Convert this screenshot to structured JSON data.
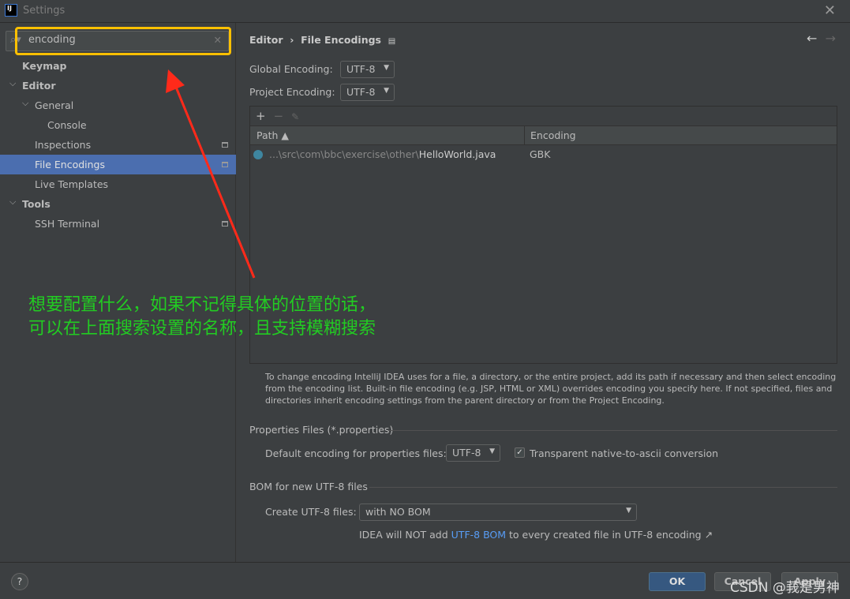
{
  "window": {
    "title": "Settings",
    "logo": "IJ"
  },
  "search": {
    "value": "encoding"
  },
  "sidebar": {
    "items": [
      {
        "label": "Keymap",
        "bold": true,
        "level": 0,
        "chev": false
      },
      {
        "label": "Editor",
        "bold": true,
        "level": 0,
        "chev": true
      },
      {
        "label": "General",
        "level": 1,
        "chev": true
      },
      {
        "label": "Console",
        "level": 2
      },
      {
        "label": "Inspections",
        "level": 1,
        "mod": true
      },
      {
        "label": "File Encodings",
        "level": 1,
        "mod": true,
        "selected": true
      },
      {
        "label": "Live Templates",
        "level": 1
      },
      {
        "label": "Tools",
        "bold": true,
        "level": 0,
        "chev": true
      },
      {
        "label": "SSH Terminal",
        "level": 1,
        "mod": true
      }
    ]
  },
  "breadcrumb": {
    "parent": "Editor",
    "sep": "›",
    "current": "File Encodings"
  },
  "global_encoding": {
    "label": "Global Encoding:",
    "value": "UTF-8"
  },
  "project_encoding": {
    "label": "Project Encoding:",
    "value": "UTF-8"
  },
  "table": {
    "col_path": "Path ▲",
    "col_encoding": "Encoding",
    "rows": [
      {
        "path_prefix": "...\\src\\com\\bbc\\exercise\\other\\",
        "file": "HelloWorld.java",
        "encoding": "GBK"
      }
    ]
  },
  "help_text": "To change encoding IntelliJ IDEA uses for a file, a directory, or the entire project, add its path if necessary and then select encoding from the encoding list. Built-in file encoding (e.g. JSP, HTML or XML) overrides encoding you specify here. If not specified, files and directories inherit encoding settings from the parent directory or from the Project Encoding.",
  "properties": {
    "section": "Properties Files (*.properties)",
    "label": "Default encoding for properties files:",
    "value": "UTF-8",
    "checkbox_label": "Transparent native-to-ascii conversion",
    "checked": true
  },
  "bom": {
    "section": "BOM for new UTF-8 files",
    "label": "Create UTF-8 files:",
    "value": "with NO BOM",
    "note_pre": "IDEA will NOT add ",
    "note_link": "UTF-8 BOM",
    "note_post": " to every created file in UTF-8 encoding ↗"
  },
  "footer": {
    "help": "?",
    "ok": "OK",
    "cancel": "Cancel",
    "apply": "Apply"
  },
  "annotation": {
    "line1": "想要配置什么，如果不记得具体的位置的话，",
    "line2": "可以在上面搜索设置的名称，且支持模糊搜索"
  },
  "watermark": "CSDN @莪是男神",
  "colors": {
    "highlight": "#ffc000",
    "arrow": "#ff2a1a",
    "annotation": "#22cc22",
    "selection": "#4b6eaf"
  }
}
